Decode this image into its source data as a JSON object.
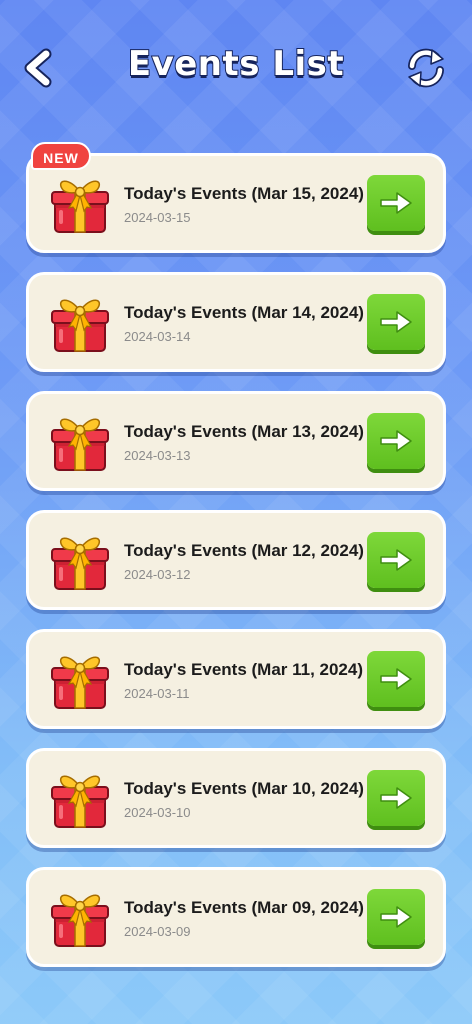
{
  "header": {
    "title": "Events List"
  },
  "events": [
    {
      "title": "Today's Events (Mar 15, 2024)",
      "date": "2024-03-15",
      "badge": "NEW"
    },
    {
      "title": "Today's Events (Mar 14, 2024)",
      "date": "2024-03-14"
    },
    {
      "title": "Today's Events (Mar 13, 2024)",
      "date": "2024-03-13"
    },
    {
      "title": "Today's Events (Mar 12, 2024)",
      "date": "2024-03-12"
    },
    {
      "title": "Today's Events (Mar 11, 2024)",
      "date": "2024-03-11"
    },
    {
      "title": "Today's Events (Mar 10, 2024)",
      "date": "2024-03-10"
    },
    {
      "title": "Today's Events (Mar 09, 2024)",
      "date": "2024-03-09"
    }
  ],
  "icons": {
    "back": "chevron-left-icon",
    "refresh": "refresh-icon",
    "gift": "gift-box-icon",
    "go": "arrow-right-icon"
  },
  "colors": {
    "card_background": "#f5f0e1",
    "badge": "#f0433f",
    "go_button": "#6acb2a",
    "background_top": "#5f86f2",
    "background_bottom": "#8cc9f9"
  }
}
